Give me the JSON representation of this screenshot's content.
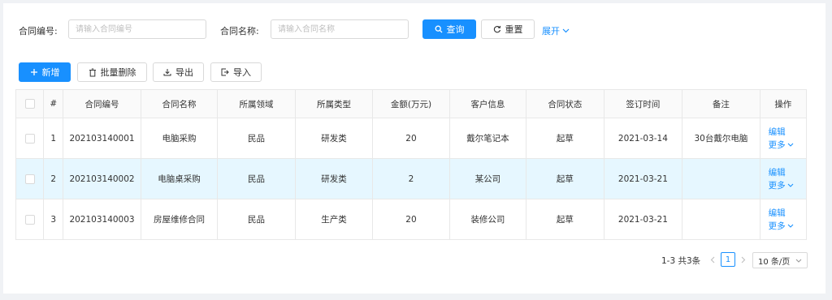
{
  "filters": {
    "contract_no_label": "合同编号:",
    "contract_no_placeholder": "请输入合同编号",
    "contract_name_label": "合同名称:",
    "contract_name_placeholder": "请输入合同名称",
    "query_label": "查询",
    "reset_label": "重置",
    "expand_label": "展开"
  },
  "toolbar": {
    "add_label": "新增",
    "batch_delete_label": "批量删除",
    "export_label": "导出",
    "import_label": "导入"
  },
  "table": {
    "columns": [
      "#",
      "合同编号",
      "合同名称",
      "所属领域",
      "所属类型",
      "金额(万元)",
      "客户信息",
      "合同状态",
      "签订时间",
      "备注",
      "操作"
    ],
    "rows": [
      {
        "idx": "1",
        "contract_no": "202103140001",
        "name": "电脑采购",
        "domain": "民品",
        "type": "研发类",
        "amount": "20",
        "customer": "戴尔笔记本",
        "status": "起草",
        "date": "2021-03-14",
        "note": "30台戴尔电脑"
      },
      {
        "idx": "2",
        "contract_no": "202103140002",
        "name": "电脑桌采购",
        "domain": "民品",
        "type": "研发类",
        "amount": "2",
        "customer": "某公司",
        "status": "起草",
        "date": "2021-03-21",
        "note": ""
      },
      {
        "idx": "3",
        "contract_no": "202103140003",
        "name": "房屋维修合同",
        "domain": "民品",
        "type": "生产类",
        "amount": "20",
        "customer": "装修公司",
        "status": "起草",
        "date": "2021-03-21",
        "note": ""
      }
    ],
    "edit_label": "编辑",
    "more_label": "更多"
  },
  "pagination": {
    "summary": "1-3 共3条",
    "current_page": "1",
    "page_size": "10 条/页"
  },
  "colors": {
    "primary": "#1890ff",
    "highlight_row": "#e6f7ff"
  }
}
